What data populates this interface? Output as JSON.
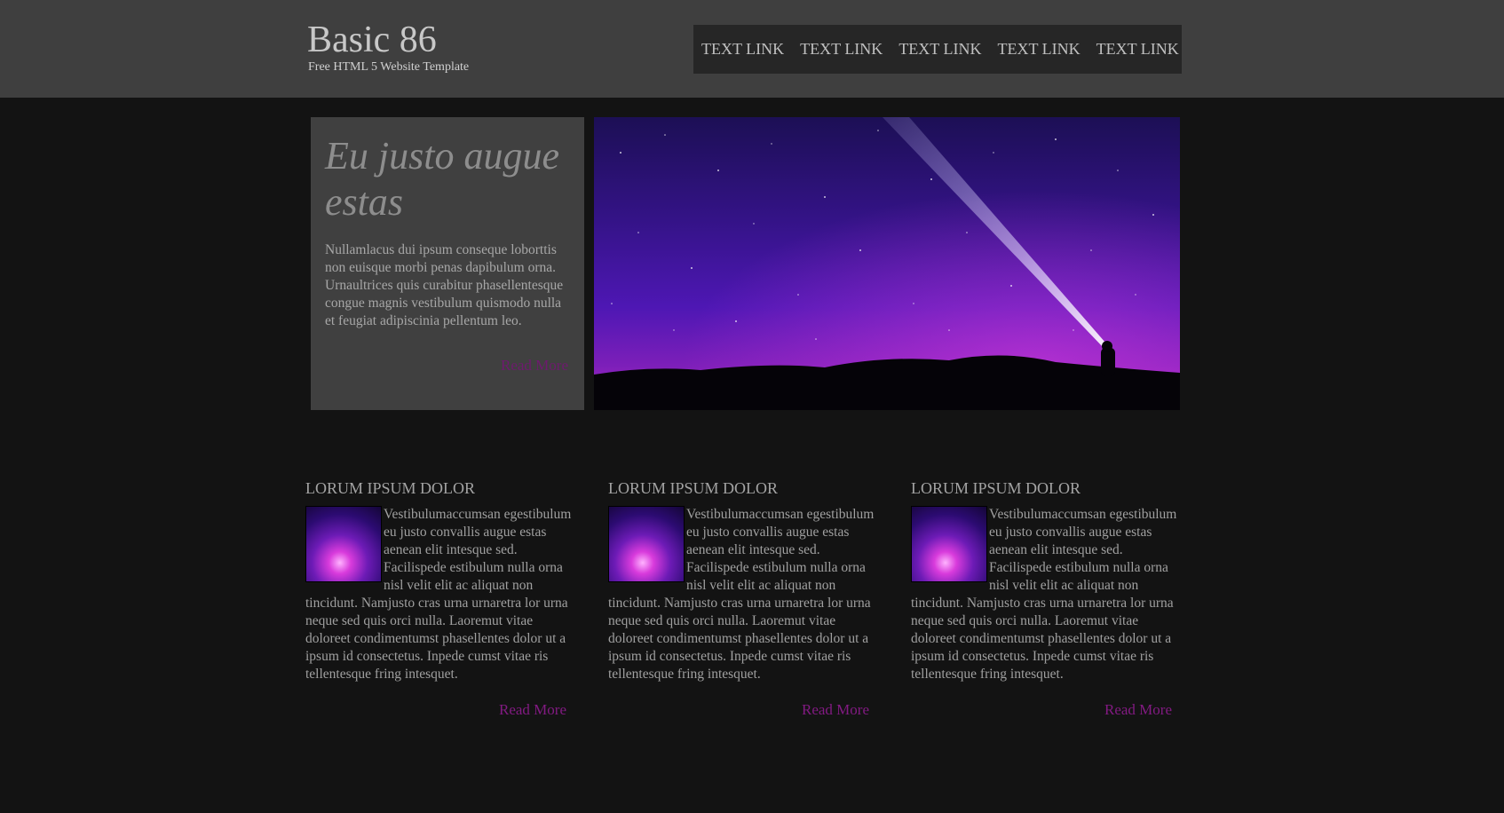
{
  "site": {
    "title": "Basic 86",
    "subtitle": "Free HTML 5 Website Template"
  },
  "nav": {
    "links": [
      "TEXT LINK",
      "TEXT LINK",
      "TEXT LINK",
      "TEXT LINK",
      "TEXT LINK"
    ]
  },
  "intro": {
    "heading": "Eu justo augue estas",
    "text": "Nullamlacus dui ipsum conseque loborttis non euisque morbi penas dapibulum orna. Urnaultrices quis curabitur phasellentesque congue magnis vestibulum quismodo nulla et feugiat adipiscinia pellentum leo.",
    "read_more": "Read More"
  },
  "columns": [
    {
      "heading": "LORUM IPSUM DOLOR",
      "text": "Vestibulumaccumsan egestibulum eu justo convallis augue estas aenean elit intesque sed. Facilispede estibulum nulla orna nisl velit elit ac aliquat non tincidunt. Namjusto cras urna urnaretra lor urna neque sed quis orci nulla. Laoremut vitae doloreet condimentumst phasellentes dolor ut a ipsum id consectetus. Inpede cumst vitae ris tellentesque fring intesquet.",
      "read_more": "Read More"
    },
    {
      "heading": "LORUM IPSUM DOLOR",
      "text": "Vestibulumaccumsan egestibulum eu justo convallis augue estas aenean elit intesque sed. Facilispede estibulum nulla orna nisl velit elit ac aliquat non tincidunt. Namjusto cras urna urnaretra lor urna neque sed quis orci nulla. Laoremut vitae doloreet condimentumst phasellentes dolor ut a ipsum id consectetus. Inpede cumst vitae ris tellentesque fring intesquet.",
      "read_more": "Read More"
    },
    {
      "heading": "LORUM IPSUM DOLOR",
      "text": "Vestibulumaccumsan egestibulum eu justo convallis augue estas aenean elit intesque sed. Facilispede estibulum nulla orna nisl velit elit ac aliquat non tincidunt. Namjusto cras urna urnaretra lor urna neque sed quis orci nulla. Laoremut vitae doloreet condimentumst phasellentes dolor ut a ipsum id consectetus. Inpede cumst vitae ris tellentesque fring intesquet.",
      "read_more": "Read More"
    }
  ],
  "colors": {
    "page_bg": "#131313",
    "header_bg": "#3f3f3f",
    "nav_bg": "#262626",
    "accent": "#821a82"
  }
}
